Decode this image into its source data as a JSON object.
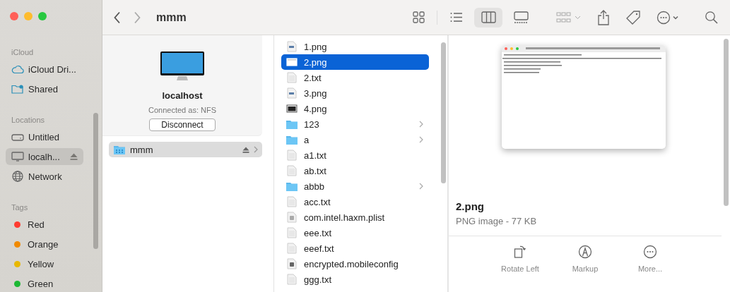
{
  "window": {
    "title": "mmm"
  },
  "toolbar": {
    "view_modes": [
      {
        "kind": "icons",
        "selected": false
      },
      {
        "kind": "list",
        "selected": false
      },
      {
        "kind": "columns",
        "selected": true
      },
      {
        "kind": "gallery",
        "selected": false
      }
    ]
  },
  "sidebar": {
    "sections": [
      {
        "heading": "iCloud",
        "items": [
          {
            "label": "iCloud Dri...",
            "kind": "cloud",
            "selected": false
          },
          {
            "label": "Shared",
            "kind": "shared",
            "selected": false
          }
        ]
      },
      {
        "heading": "Locations",
        "items": [
          {
            "label": "Untitled",
            "kind": "disk",
            "selected": false,
            "eject": false
          },
          {
            "label": "localh...",
            "kind": "computer",
            "selected": true,
            "eject": true
          },
          {
            "label": "Network",
            "kind": "network",
            "selected": false,
            "eject": false
          }
        ]
      },
      {
        "heading": "Tags",
        "items": [
          {
            "label": "Red",
            "kind": "tag",
            "color": "#ff3b30",
            "selected": false
          },
          {
            "label": "Orange",
            "kind": "tag",
            "color": "#f08a00",
            "selected": false
          },
          {
            "label": "Yellow",
            "kind": "tag",
            "color": "#e8b800",
            "selected": false
          },
          {
            "label": "Green",
            "kind": "tag",
            "color": "#1cb833",
            "selected": false
          }
        ]
      }
    ]
  },
  "server": {
    "name": "localhost",
    "status": "Connected as: NFS",
    "button": "Disconnect",
    "shares": [
      {
        "name": "mmm",
        "selected": true
      }
    ]
  },
  "files": [
    {
      "name": "1.png",
      "kind": "image",
      "selected": false
    },
    {
      "name": "2.png",
      "kind": "screenshot",
      "selected": true
    },
    {
      "name": "2.txt",
      "kind": "text",
      "selected": false
    },
    {
      "name": "3.png",
      "kind": "image",
      "selected": false
    },
    {
      "name": "4.png",
      "kind": "dark-image",
      "selected": false
    },
    {
      "name": "123",
      "kind": "folder",
      "selected": false
    },
    {
      "name": "a",
      "kind": "folder",
      "selected": false
    },
    {
      "name": "a1.txt",
      "kind": "text",
      "selected": false
    },
    {
      "name": "ab.txt",
      "kind": "text",
      "selected": false
    },
    {
      "name": "abbb",
      "kind": "folder",
      "selected": false
    },
    {
      "name": "acc.txt",
      "kind": "text",
      "selected": false
    },
    {
      "name": "com.intel.haxm.plist",
      "kind": "plist",
      "selected": false
    },
    {
      "name": "eee.txt",
      "kind": "text",
      "selected": false
    },
    {
      "name": "eeef.txt",
      "kind": "text",
      "selected": false
    },
    {
      "name": "encrypted.mobileconfig",
      "kind": "config",
      "selected": false
    },
    {
      "name": "ggg.txt",
      "kind": "text",
      "selected": false
    }
  ],
  "preview": {
    "name": "2.png",
    "info": "PNG image - 77 KB",
    "actions": [
      {
        "label": "Rotate Left",
        "kind": "rotate"
      },
      {
        "label": "Markup",
        "kind": "markup"
      },
      {
        "label": "More...",
        "kind": "more"
      }
    ]
  }
}
